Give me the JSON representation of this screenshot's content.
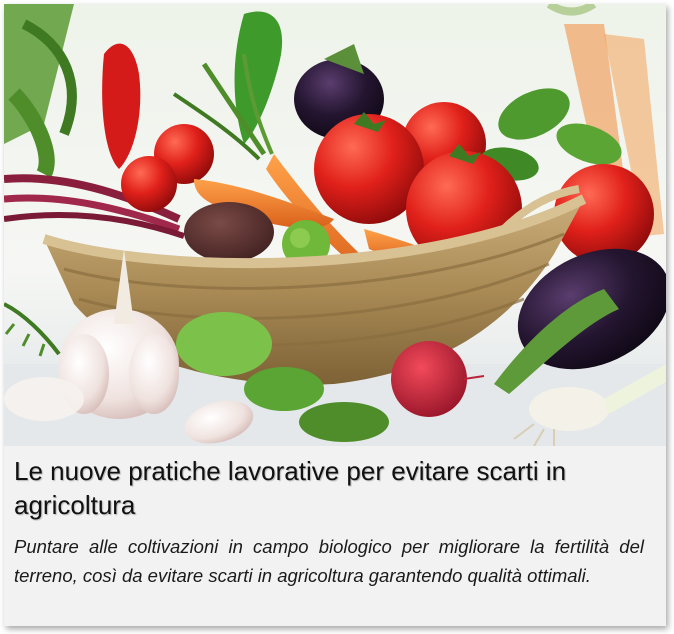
{
  "article": {
    "image_alt": "Cesto di verdure fresche: pomodori, carote, peperoncini, melanzane, aglio, barbabietola, ravanello e basilico",
    "title": "Le nuove pratiche lavorative per evitare scarti in agricoltura",
    "summary": "Puntare alle coltivazioni in campo biologico per migliorare la fertilità del terreno, così da evitare scarti in agricoltura garantendo qualità ottimali."
  },
  "colors": {
    "card_background": "#f2f2f2",
    "title_text": "#111111",
    "summary_text": "#1b1b1b"
  }
}
